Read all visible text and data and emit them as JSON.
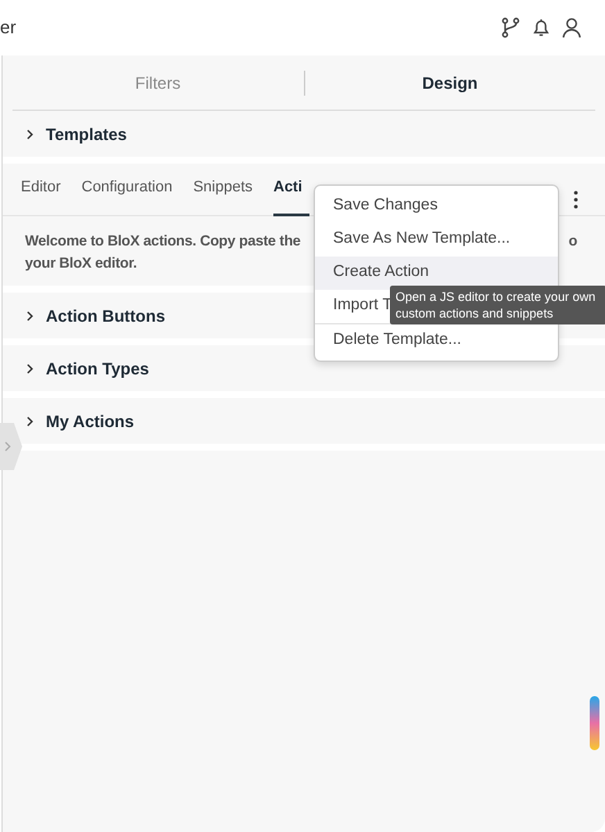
{
  "header": {
    "title": "er"
  },
  "panel_tabs": [
    {
      "label": "Filters",
      "selected": false
    },
    {
      "label": "Design",
      "selected": true
    }
  ],
  "templates_section": {
    "label": "Templates",
    "expanded": false
  },
  "editor_tabs": [
    {
      "label": "Editor",
      "selected": false
    },
    {
      "label": "Configuration",
      "selected": false
    },
    {
      "label": "Snippets",
      "selected": false
    },
    {
      "label": "Acti",
      "selected": true
    }
  ],
  "intro": {
    "line_1": "Welcome to BloX actions. Copy paste the",
    "line_1_end": "o",
    "line_2": "your BloX editor."
  },
  "sections": [
    {
      "label": "Action Buttons",
      "expanded": false
    },
    {
      "label": "Action Types",
      "expanded": false
    },
    {
      "label": "My Actions",
      "expanded": false
    }
  ],
  "menu": {
    "items": [
      {
        "label": "Save Changes",
        "selected": false
      },
      {
        "label": "Save As New Template...",
        "selected": false
      },
      {
        "label": "Create Action",
        "selected": true
      },
      {
        "label": "Import T",
        "selected": false
      },
      {
        "label": "Delete Template...",
        "selected": false
      }
    ]
  },
  "tooltip": {
    "text": "Open a JS editor to create your own custom actions and snippets"
  }
}
